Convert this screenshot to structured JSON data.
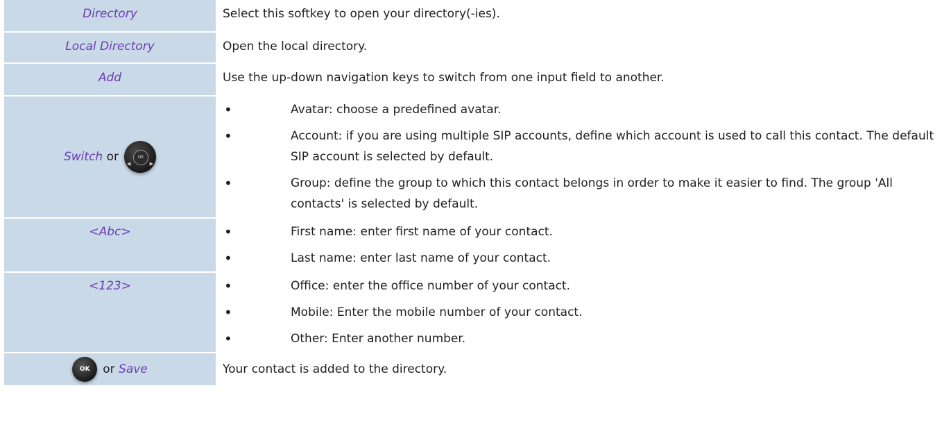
{
  "rows": [
    {
      "key": "Directory",
      "desc": "Select this softkey to open your directory(-ies)."
    },
    {
      "key": "Local Directory",
      "desc": "Open the local directory."
    },
    {
      "key": "Add",
      "desc": "Use the up-down navigation keys to switch from one input field to another."
    },
    {
      "key": "Switch",
      "connector": "or",
      "icon": "navigator-key-icon",
      "bullets": [
        "Avatar: choose a predefined avatar.",
        "Account: if you are using multiple SIP accounts, define which account is used to call this contact. The default SIP account is selected by default.",
        "Group: define the group to which this contact belongs in order to make it easier to find. The group 'All contacts' is selected by default."
      ]
    },
    {
      "key": "<Abc>",
      "bullets": [
        "First name: enter first name of your contact.",
        "Last name: enter last name of your contact."
      ]
    },
    {
      "key": "<123>",
      "bullets": [
        "Office: enter the office number of your contact.",
        "Mobile: Enter the mobile number of your contact.",
        "Other: Enter another number."
      ]
    },
    {
      "key": "Save",
      "connector": "or",
      "icon": "ok-key-icon",
      "icon_label": "OK",
      "desc": "Your contact is added to the directory."
    }
  ],
  "nav_key_label": "OK",
  "bullet_glyph": "•",
  "colors": {
    "key_column_bg": "#c9d9e8",
    "key_text": "#6a3db0",
    "body_text": "#1f1f1f"
  }
}
